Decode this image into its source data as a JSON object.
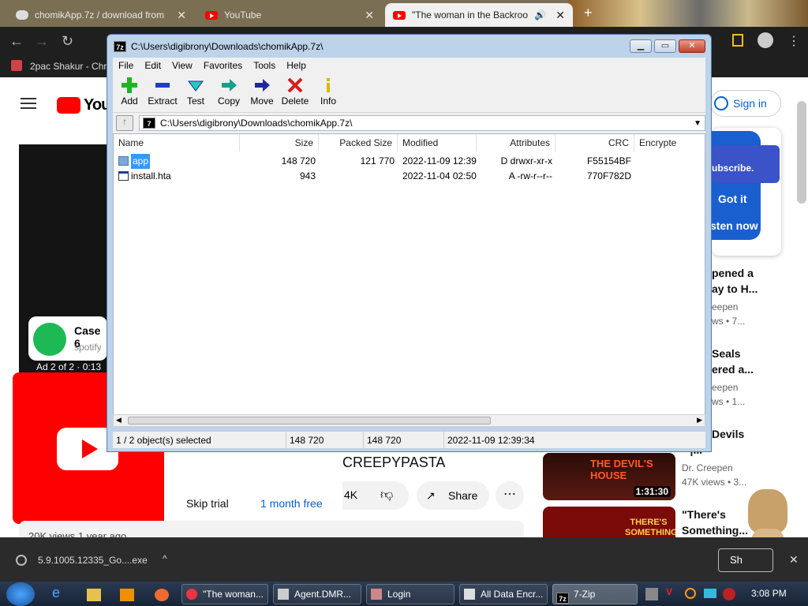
{
  "browser": {
    "tabs": [
      {
        "title": "chomikApp.7z / download from",
        "active": false
      },
      {
        "title": "YouTube",
        "active": false
      },
      {
        "title": "\"The woman in the Backroo",
        "active": true
      }
    ],
    "bookmark_label": "2pac Shakur - Chro"
  },
  "youtube": {
    "logo_text": "YouT",
    "sign_in": "Sign in",
    "subscribe_tip": "ubscribe.",
    "got_it": "Got it",
    "listen_now": "sten now",
    "ad_title": "Case 6",
    "ad_domain": "spotify",
    "ad_counter": "Ad 2 of 2 · 0:13",
    "video_title_fragment": "CREEPYPASTA",
    "likes": "4K",
    "share": "Share",
    "skip_trial": "Skip trial",
    "month_free": "1 month free",
    "views_fragment": "20K views  1 year ago",
    "sidebar": [
      {
        "title1": "pened a",
        "title2": "ay to H...",
        "channel": "eepen",
        "meta": "ws • 7..."
      },
      {
        "title1": "Seals",
        "title2": "ered a...",
        "channel": "eepen",
        "meta": "ws • 1..."
      },
      {
        "title1": "Devils",
        "title2": "\" |...",
        "channel": "Dr. Creepen",
        "meta": "47K views • 3...",
        "thumb_text": "THE DEVIL'S HOUSE",
        "duration": "1:31:30"
      },
      {
        "title1": "\"There's",
        "title2": "Something...",
        "thumb_text": "THERE'S SOMETHING"
      }
    ],
    "share_short": "Sh"
  },
  "sevenzip": {
    "title": "C:\\Users\\digibrony\\Downloads\\chomikApp.7z\\",
    "menu": [
      "File",
      "Edit",
      "View",
      "Favorites",
      "Tools",
      "Help"
    ],
    "tools": [
      "Add",
      "Extract",
      "Test",
      "Copy",
      "Move",
      "Delete",
      "Info"
    ],
    "address": "C:\\Users\\digibrony\\Downloads\\chomikApp.7z\\",
    "columns": [
      "Name",
      "Size",
      "Packed Size",
      "Modified",
      "Attributes",
      "CRC",
      "Encrypte"
    ],
    "rows": [
      {
        "name": "app",
        "size": "148 720",
        "packed": "121 770",
        "modified": "2022-11-09 12:39",
        "attributes": "D drwxr-xr-x",
        "crc": "F55154BF",
        "selected": true
      },
      {
        "name": "install.hta",
        "size": "943",
        "packed": "",
        "modified": "2022-11-04 02:50",
        "attributes": "A -rw-r--r--",
        "crc": "770F782D",
        "selected": false
      }
    ],
    "status": {
      "selection": "1 / 2 object(s) selected",
      "size": "148 720",
      "packed": "148 720",
      "date": "2022-11-09 12:39:34"
    }
  },
  "downloads": {
    "file": "5.9.1005.12335_Go....exe"
  },
  "taskbar": {
    "items": [
      "\"The woman...",
      "Agent.DMR...",
      "Login",
      "All Data Encr...",
      "7-Zip"
    ],
    "clock": "3:08 PM"
  }
}
